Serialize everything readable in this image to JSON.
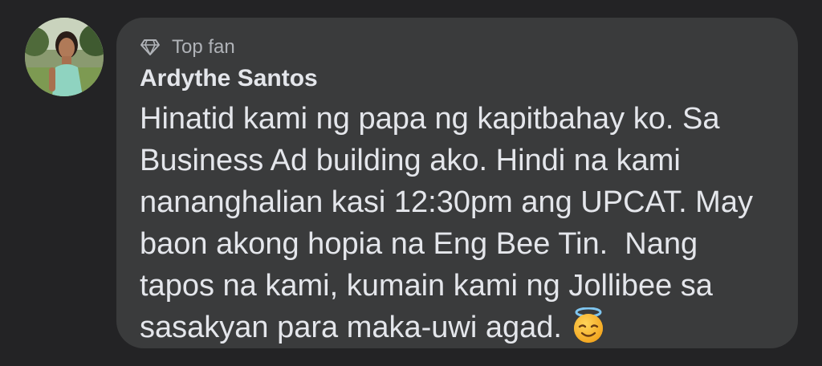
{
  "comment": {
    "badge": {
      "icon": "diamond-icon",
      "label": "Top fan"
    },
    "author": "Ardythe Santos",
    "text": "Hinatid kami ng papa ng kapitbahay ko. Sa Business Ad building ako. Hindi na kami nananghalian kasi 12:30pm ang UPCAT. May baon akong hopia na Eng Bee Tin.  Nang tapos na kami, kumain kami ng Jollibee sa sasakyan para maka-uwi agad.",
    "emoji": "smiling-face-with-halo-emoji"
  },
  "colors": {
    "background": "#232325",
    "bubble": "#3a3b3c",
    "primary_text": "#e4e6eb",
    "secondary_text": "#b0b3b8"
  }
}
